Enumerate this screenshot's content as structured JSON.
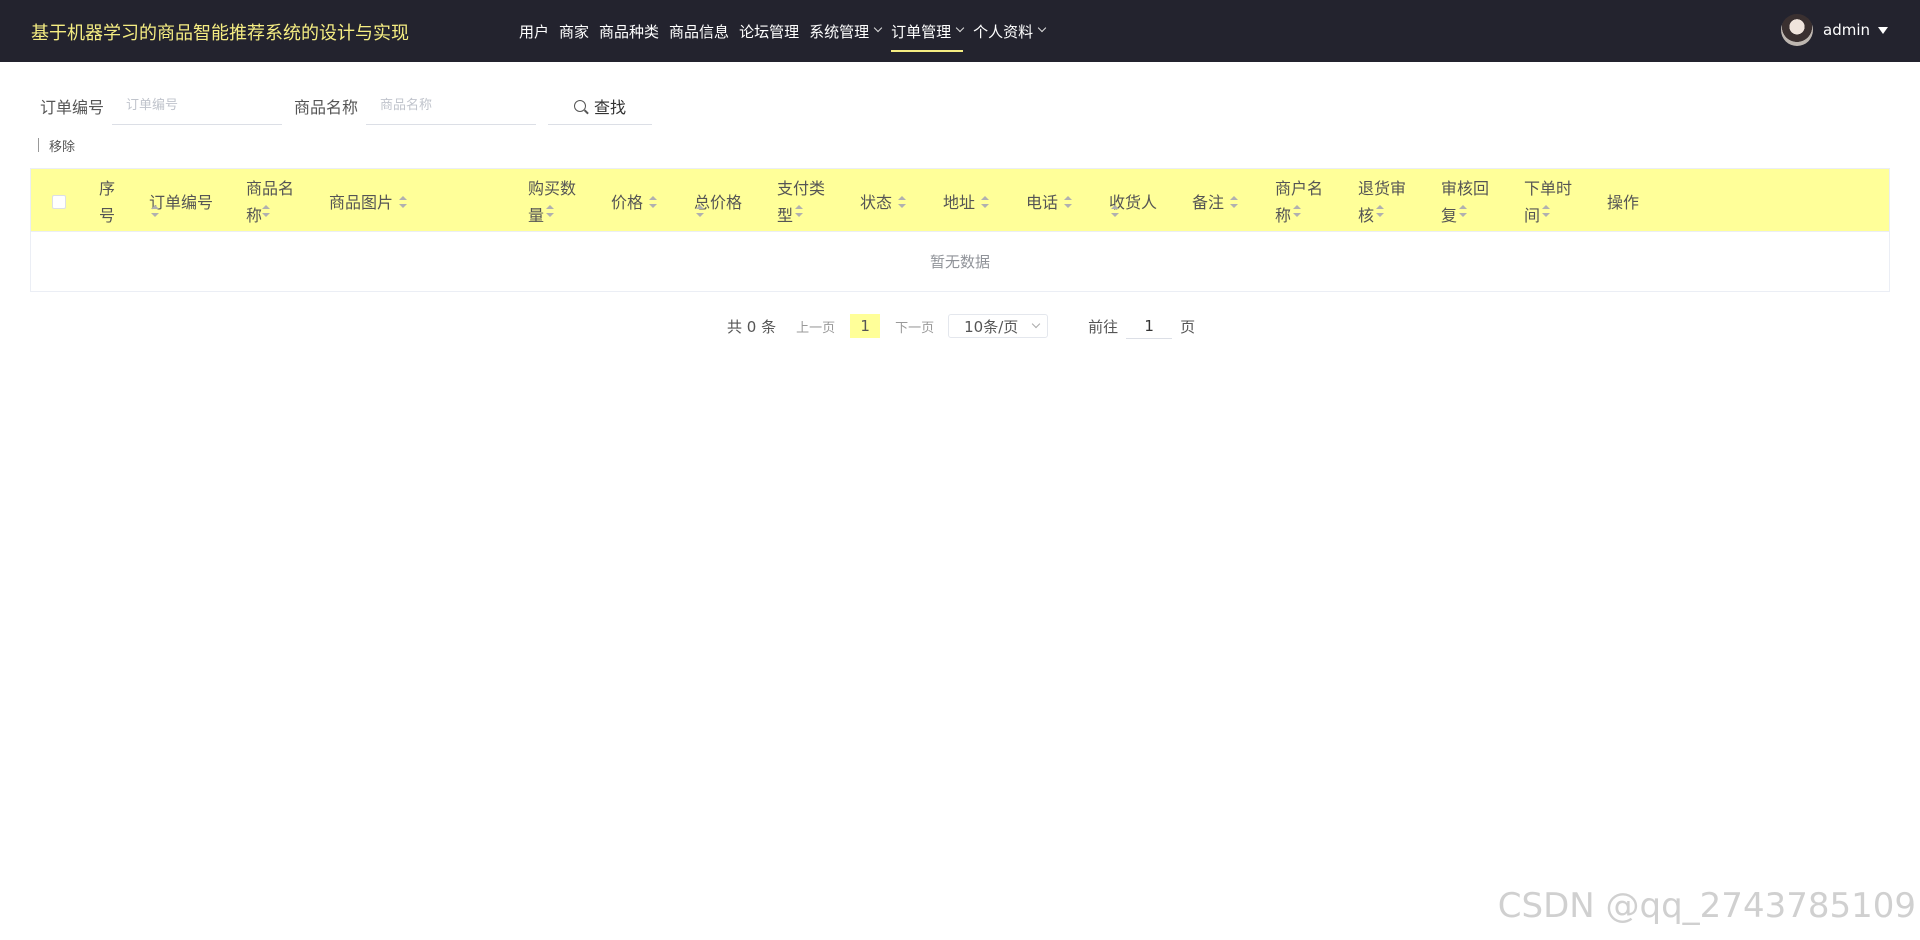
{
  "app": {
    "title": "基于机器学习的商品智能推荐系统的设计与实现"
  },
  "nav": {
    "items": [
      {
        "label": "用户",
        "dropdown": false,
        "active": false
      },
      {
        "label": "商家",
        "dropdown": false,
        "active": false
      },
      {
        "label": "商品种类",
        "dropdown": false,
        "active": false
      },
      {
        "label": "商品信息",
        "dropdown": false,
        "active": false
      },
      {
        "label": "论坛管理",
        "dropdown": false,
        "active": false
      },
      {
        "label": "系统管理",
        "dropdown": true,
        "active": false
      },
      {
        "label": "订单管理",
        "dropdown": true,
        "active": true
      },
      {
        "label": "个人资料",
        "dropdown": true,
        "active": false
      }
    ]
  },
  "user": {
    "name": "admin"
  },
  "search": {
    "order_no_label": "订单编号",
    "order_no_placeholder": "订单编号",
    "order_no_value": "",
    "product_name_label": "商品名称",
    "product_name_placeholder": "商品名称",
    "product_name_value": "",
    "search_button": "查找"
  },
  "actions": {
    "remove": "移除"
  },
  "table": {
    "columns": [
      {
        "label": "序号",
        "sortable": false
      },
      {
        "label": "订单编号",
        "sortable": true
      },
      {
        "label": "商品名称",
        "sortable": true
      },
      {
        "label": "商品图片",
        "sortable": true
      },
      {
        "label": "购买数量",
        "sortable": true
      },
      {
        "label": "价格",
        "sortable": true
      },
      {
        "label": "总价格",
        "sortable": true
      },
      {
        "label": "支付类型",
        "sortable": true
      },
      {
        "label": "状态",
        "sortable": true
      },
      {
        "label": "地址",
        "sortable": true
      },
      {
        "label": "电话",
        "sortable": true
      },
      {
        "label": "收货人",
        "sortable": true
      },
      {
        "label": "备注",
        "sortable": true
      },
      {
        "label": "商户名称",
        "sortable": true
      },
      {
        "label": "退货审核",
        "sortable": true
      },
      {
        "label": "审核回复",
        "sortable": true
      },
      {
        "label": "下单时间",
        "sortable": true
      },
      {
        "label": "操作",
        "sortable": false
      }
    ],
    "rows": [],
    "empty_text": "暂无数据"
  },
  "pagination": {
    "total_text": "共 0 条",
    "prev": "上一页",
    "current_page": "1",
    "next": "下一页",
    "page_size": "10条/页",
    "goto_label": "前往",
    "goto_value": "1",
    "page_unit": "页"
  },
  "watermark": "CSDN @qq_2743785109",
  "colors": {
    "navbar_bg": "#23232e",
    "title": "#f5ed82",
    "accent_header": "#ffff99"
  }
}
